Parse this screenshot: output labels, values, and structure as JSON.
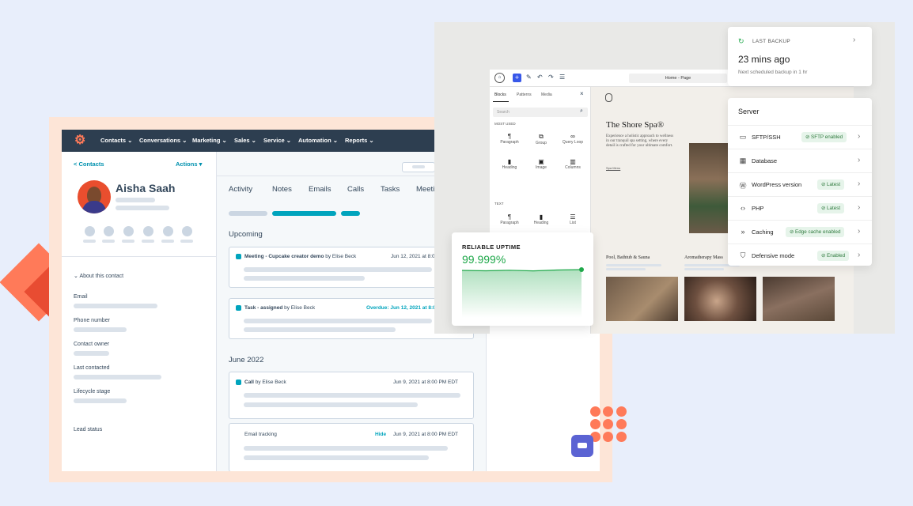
{
  "hubspot": {
    "nav": [
      "Contacts ⌄",
      "Conversations ⌄",
      "Marketing ⌄",
      "Sales ⌄",
      "Service ⌄",
      "Automation ⌄",
      "Reports ⌄"
    ],
    "back_link": "< Contacts",
    "actions": "Actions ▾",
    "contact_name": "Aisha Saah",
    "about": "About this contact",
    "fields": [
      "Email",
      "Phone number",
      "Contact owner",
      "Last contacted",
      "Lifecycle stage",
      "Lead status"
    ],
    "tabs": [
      "Activity",
      "Notes",
      "Emails",
      "Calls",
      "Tasks",
      "Meeti"
    ],
    "upcoming": "Upcoming",
    "june": "June 2022",
    "cards": [
      {
        "title": "Meeting - Cupcake creator demo",
        "by": " by Elise Beck",
        "date": "Jun 12, 2021 at 8:0"
      },
      {
        "title": "Task - assigned",
        "by": " by Elise Beck",
        "date": "Overdue: Jun 12, 2021 at 8:0"
      },
      {
        "title": "Call",
        "by": " by Elise Beck",
        "date": "Jun 9, 2021 at 8:00 PM EDT"
      },
      {
        "title": "Email tracking",
        "hide": "Hide",
        "date": "Jun 9, 2021 at 8:00 PM EDT"
      }
    ]
  },
  "wordpress": {
    "page_title": "Home - Page",
    "side_tabs": [
      "Blocks",
      "Patterns",
      "Media"
    ],
    "search": "Search",
    "most_used": "MOST USED",
    "text_label": "TEXT",
    "blocks": [
      {
        "icon": "¶",
        "label": "Paragraph"
      },
      {
        "icon": "⧉",
        "label": "Group"
      },
      {
        "icon": "∞",
        "label": "Query Loop"
      },
      {
        "icon": "▮",
        "label": "Heading"
      },
      {
        "icon": "▣",
        "label": "Image"
      },
      {
        "icon": "▥",
        "label": "Columns"
      }
    ],
    "text_blocks": [
      {
        "icon": "¶",
        "label": "Paragraph"
      },
      {
        "icon": "▮",
        "label": "Heading"
      },
      {
        "icon": "☰",
        "label": "List"
      }
    ],
    "site_title": "The Shore Spa®",
    "site_desc": "Experience a holistic approach to wellness in our tranquil spa setting, where every detail is crafted for your ultimate comfort.",
    "more": "Spa Menu",
    "services": [
      "Pool, Bathtub & Sauna",
      "Aromatherapy Mass",
      ""
    ]
  },
  "uptime": {
    "label": "RELIABLE UPTIME",
    "value": "99.999%",
    "color": "#1fa84a"
  },
  "backup": {
    "label": "LAST BACKUP",
    "value": "23 mins ago",
    "sub": "Next scheduled backup in 1 hr"
  },
  "server": {
    "title": "Server",
    "rows": [
      {
        "icon": "folder-icon",
        "label": "SFTP/SSH",
        "badge": "⊘ SFTP enabled"
      },
      {
        "icon": "database-icon",
        "label": "Database",
        "badge": ""
      },
      {
        "icon": "wordpress-icon",
        "label": "WordPress version",
        "badge": "⊘ Latest"
      },
      {
        "icon": "code-icon",
        "label": "PHP",
        "badge": "⊘ Latest"
      },
      {
        "icon": "caching-icon",
        "label": "Caching",
        "badge": "⊘ Edge cache enabled"
      },
      {
        "icon": "shield-icon",
        "label": "Defensive mode",
        "badge": "⊘ Enabled"
      }
    ]
  }
}
